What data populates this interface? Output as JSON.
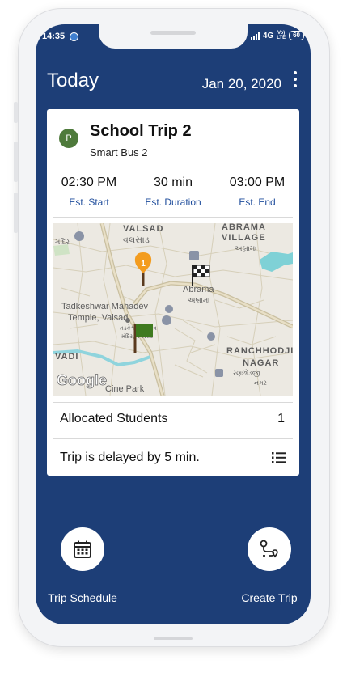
{
  "status_bar": {
    "time": "14:35",
    "network": "4G",
    "volte_top": "Vo)",
    "volte_bottom": "LTE",
    "battery": "60"
  },
  "header": {
    "title": "Today",
    "date": "Jan 20, 2020"
  },
  "trip": {
    "avatar_letter": "P",
    "title": "School Trip 2",
    "bus": "Smart Bus 2",
    "times": [
      {
        "value": "02:30 PM",
        "label": "Est. Start"
      },
      {
        "value": "30 min",
        "label": "Est. Duration"
      },
      {
        "value": "03:00 PM",
        "label": "Est. End"
      }
    ]
  },
  "map": {
    "labels": {
      "valsad_en": "VALSAD",
      "valsad_gu": "વલસાડ",
      "abrama_village": "ABRAMA",
      "village": "VILLAGE",
      "abrama_village_gu": "અબ્રામા",
      "abrama": "Abrama",
      "abrama_gu": "અબ્રામા",
      "tadkeshwar_1": "Tadkeshwar Mahadev",
      "tadkeshwar_2": "Temple, Valsad",
      "tadkeshwar_gu_1": "તડકેશ્વર મહાદેવ",
      "tadkeshwar_gu_2": "મંદિર, વલસાડ",
      "ranchhodji": "RANCHHODJI",
      "nagar": "NAGAR",
      "ranchhodji_gu": "રણછોડજી",
      "nagar_gu": "નગર",
      "vadi": "VADI",
      "cine_park": "Cine Park",
      "mandir": "મંદિર",
      "google": "Google"
    },
    "stop_number": "1"
  },
  "allocated": {
    "label": "Allocated Students",
    "count": "1"
  },
  "delay": {
    "text": "Trip is delayed by 5 min."
  },
  "actions": {
    "schedule_label": "Trip Schedule",
    "create_label": "Create Trip"
  },
  "colors": {
    "primary": "#1d3e77",
    "accent_text": "#1f4d9c",
    "avatar": "#4e7a3b",
    "stop_marker": "#f39c1f",
    "start_flag": "#3f7a1f"
  }
}
